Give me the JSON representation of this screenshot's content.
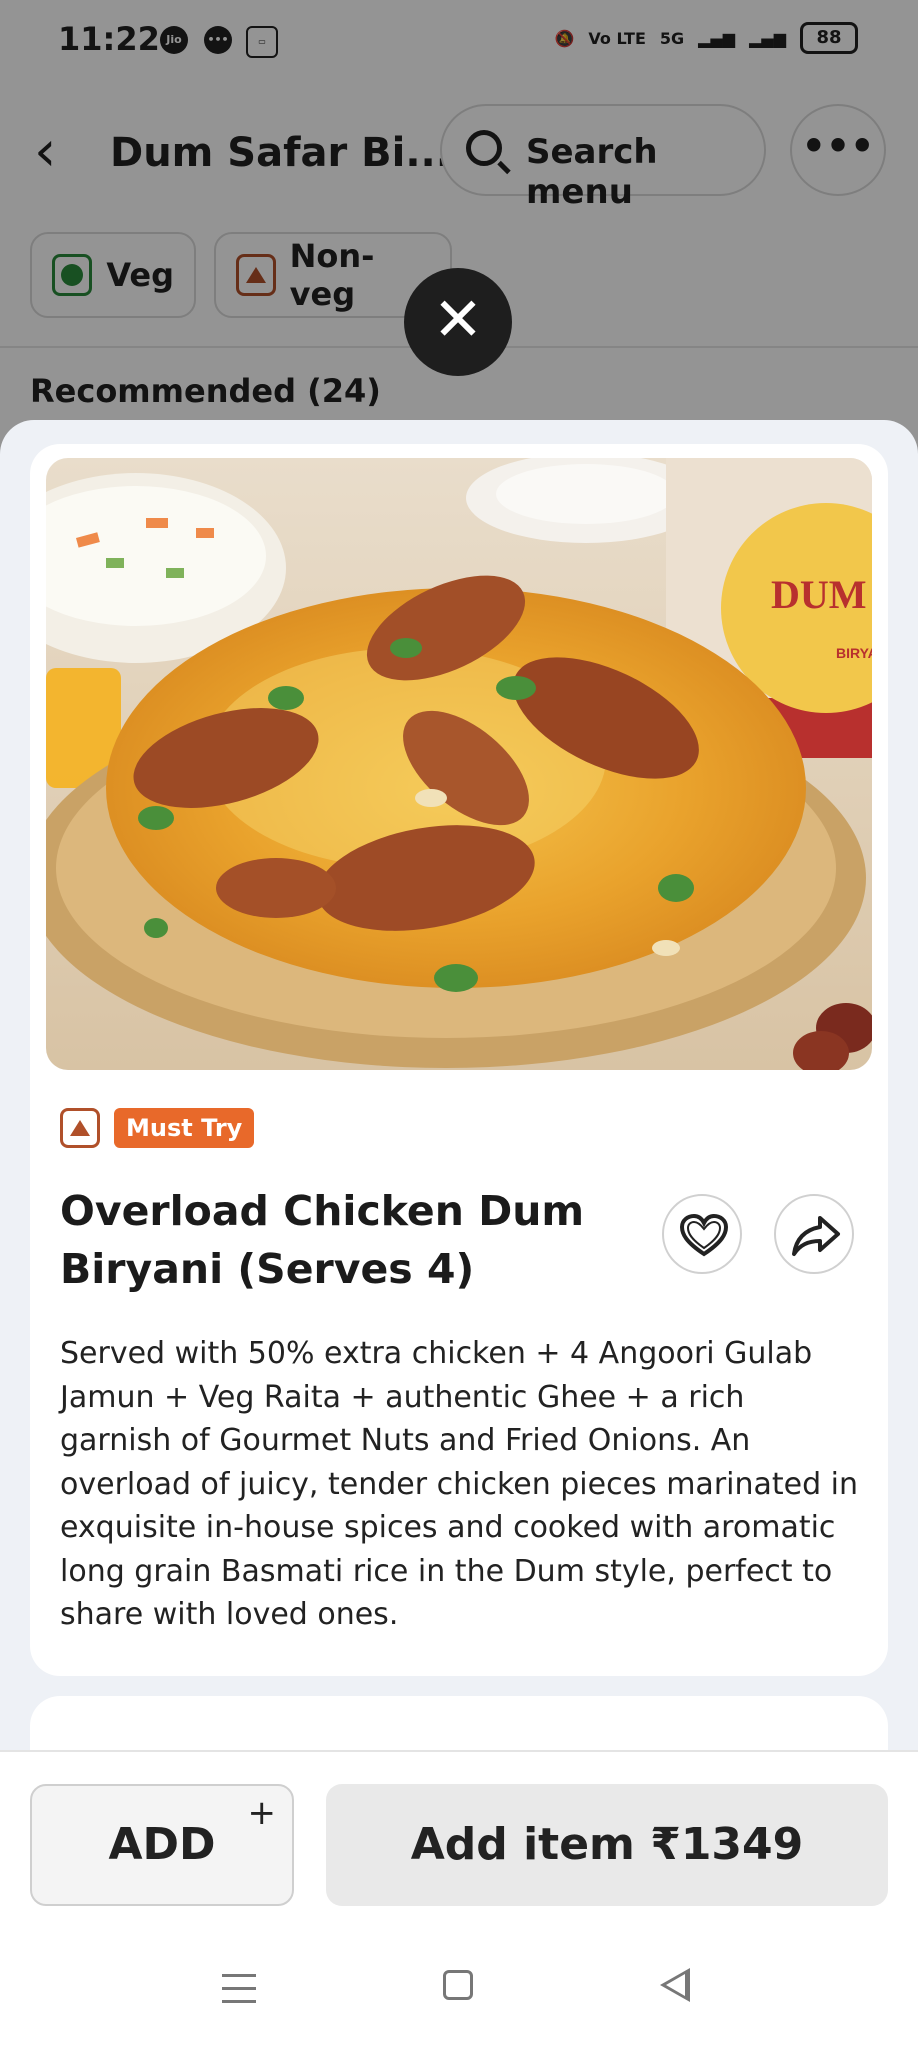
{
  "status_bar": {
    "time": "11:22",
    "carrier_icon": "Jio",
    "battery": "88",
    "network": "5G",
    "volte": "Vo LTE"
  },
  "header": {
    "title": "Dum Safar Bi...",
    "search_placeholder": "Search menu",
    "more_label": "•••"
  },
  "filters": [
    {
      "label": "Veg"
    },
    {
      "label": "Non-veg"
    }
  ],
  "section": {
    "title": "Recommended (24)"
  },
  "dish": {
    "badge": "Must Try",
    "name": "Overload Chicken Dum Biryani (Serves 4)",
    "description": "Served with 50% extra chicken + 4 Angoori Gulab Jamun + Veg Raita + authentic Ghee + a rich garnish of Gourmet Nuts and Fried Onions. An overload of juicy, tender chicken pieces marinated in exquisite in-house spices and cooked with aromatic long grain Basmati rice in the Dum style, perfect to share with loved ones.",
    "image_brand_text": "DUM S",
    "image_brand_sub": "BIRYA"
  },
  "actions": {
    "add_label": "ADD",
    "add_plus": "+",
    "add_item_label": "Add item ₹1349"
  },
  "icons": {
    "close": "close-icon",
    "heart": "heart-icon",
    "share": "share-icon",
    "back": "back-icon",
    "search": "search-icon"
  },
  "colors": {
    "veg": "#2a8a3c",
    "non_veg": "#b0502a",
    "badge": "#e8692a",
    "sheet_bg": "#eef1f6"
  }
}
